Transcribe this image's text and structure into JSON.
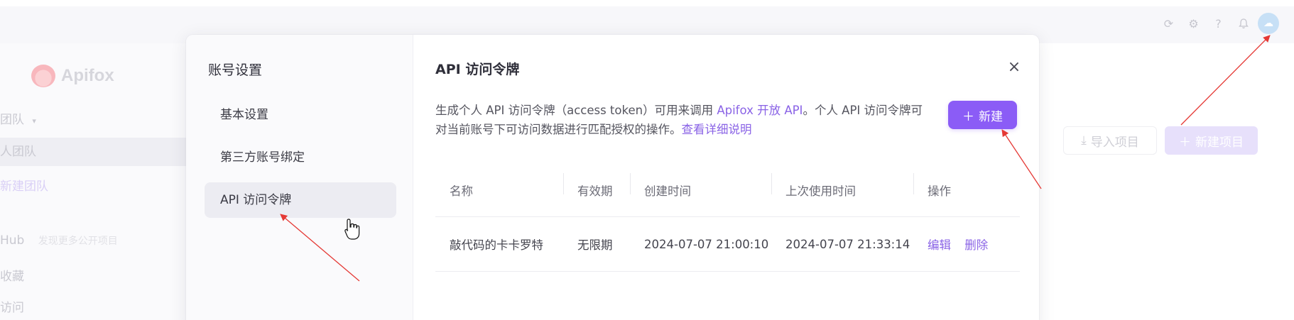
{
  "app": {
    "brand": "Apifox",
    "header_icons": [
      "refresh-icon",
      "gear-icon",
      "help-icon",
      "bell-icon"
    ],
    "sidebar": {
      "team_header": "团队",
      "selected_team": "人团队",
      "new_team": "新建团队",
      "hub_label": "Hub",
      "hub_sub": "发现更多公开项目",
      "favorites": "收藏",
      "recent": "访问"
    },
    "actions": {
      "import_project": "导入项目",
      "new_project": "新建项目"
    }
  },
  "modal": {
    "nav_title": "账号设置",
    "nav_items": [
      {
        "label": "基本设置"
      },
      {
        "label": "第三方账号绑定"
      },
      {
        "label": "API 访问令牌"
      }
    ],
    "panel_title": "API 访问令牌",
    "close_glyph": "×",
    "description": {
      "part1": "生成个人 API 访问令牌（access token）可用来调用 ",
      "link1": "Apifox 开放 API",
      "part2": "。个人 API 访问令牌可对当前账号下可访问数据进行匹配授权的操作。",
      "link2": "查看详细说明"
    },
    "new_button": "新建",
    "table": {
      "columns": [
        "名称",
        "有效期",
        "创建时间",
        "上次使用时间",
        "操作"
      ],
      "rows": [
        {
          "name": "敲代码的卡卡罗特",
          "validity": "无限期",
          "created": "2024-07-07 21:00:10",
          "last_used": "2024-07-07 21:33:14",
          "edit": "编辑",
          "delete": "删除"
        }
      ]
    }
  },
  "colors": {
    "accent": "#8b5cf6",
    "link": "#8a63e6",
    "annotation_arrow": "#e53935"
  }
}
